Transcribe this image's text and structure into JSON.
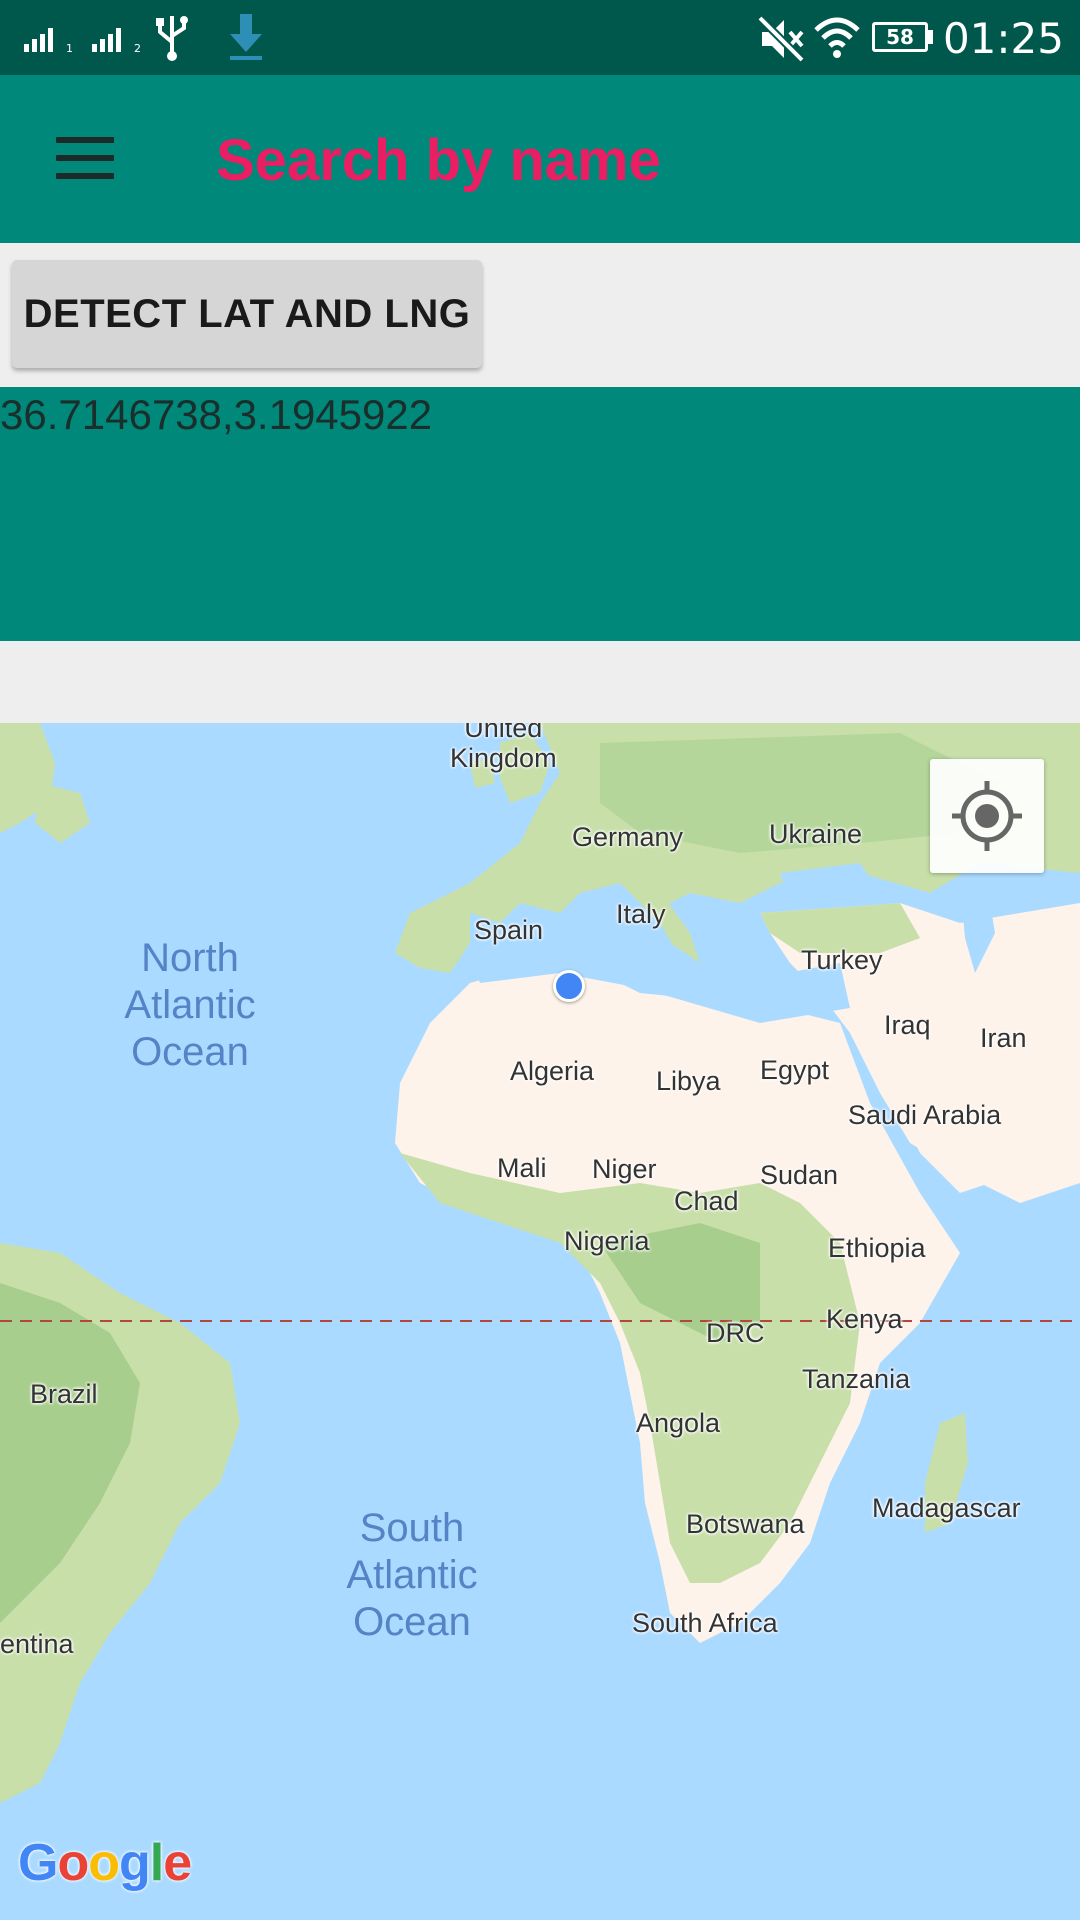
{
  "status_bar": {
    "time": "01:25",
    "battery": "58",
    "sim1_label": "1",
    "sim2_label": "2"
  },
  "toolbar": {
    "title": "Search by name",
    "title_color": "#e91e63",
    "color": "#00897b"
  },
  "detect_button": {
    "label": "DETECT LAT AND LNG"
  },
  "coordinates": {
    "text": "36.7146738,3.1945922"
  },
  "map": {
    "oceans": {
      "north_atlantic": [
        "North",
        "Atlantic",
        "Ocean"
      ],
      "south_atlantic": [
        "South",
        "Atlantic",
        "Ocean"
      ]
    },
    "labels": {
      "united_kingdom": [
        "United",
        "Kingdom"
      ],
      "germany": "Germany",
      "ukraine": "Ukraine",
      "spain": "Spain",
      "italy": "Italy",
      "turkey": "Turkey",
      "iraq": "Iraq",
      "iran": "Iran",
      "algeria": "Algeria",
      "libya": "Libya",
      "egypt": "Egypt",
      "saudi_arabia": "Saudi Arabia",
      "mali": "Mali",
      "niger": "Niger",
      "chad": "Chad",
      "sudan": "Sudan",
      "nigeria": "Nigeria",
      "ethiopia": "Ethiopia",
      "kenya": "Kenya",
      "drc": "DRC",
      "tanzania": "Tanzania",
      "brazil": "Brazil",
      "angola": "Angola",
      "madagascar": "Madagascar",
      "botswana": "Botswana",
      "south_africa": "South Africa",
      "argentina": "entina"
    },
    "logo": "Google"
  }
}
